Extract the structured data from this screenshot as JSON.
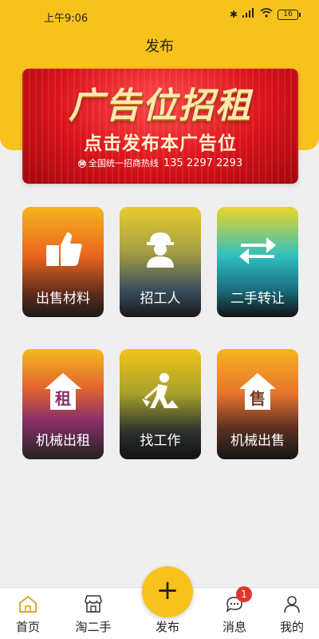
{
  "status_bar": {
    "time": "上午9:06",
    "battery": "16"
  },
  "header": {
    "title": "发布"
  },
  "banner": {
    "headline": "广告位招租",
    "subline": "点击发布本广告位",
    "hotline_label": "全国统一招商热线",
    "hotline_number": "135 2297 2293"
  },
  "categories": [
    {
      "label": "出售材料",
      "icon": "thumbs-up-icon"
    },
    {
      "label": "招工人",
      "icon": "worker-icon"
    },
    {
      "label": "二手转让",
      "icon": "swap-arrows-icon"
    },
    {
      "label": "机械出租",
      "icon": "house-rent-icon"
    },
    {
      "label": "找工作",
      "icon": "worker-shovel-icon"
    },
    {
      "label": "机械出售",
      "icon": "house-sale-icon"
    }
  ],
  "category_badges": {
    "rent": "租",
    "sale": "售"
  },
  "nav": {
    "home": "首页",
    "market": "淘二手",
    "publish": "发布",
    "publish_symbol": "+",
    "messages": "消息",
    "messages_badge": "1",
    "profile": "我的"
  },
  "colors": {
    "accent": "#f7c21c",
    "badge": "#e5352b"
  }
}
